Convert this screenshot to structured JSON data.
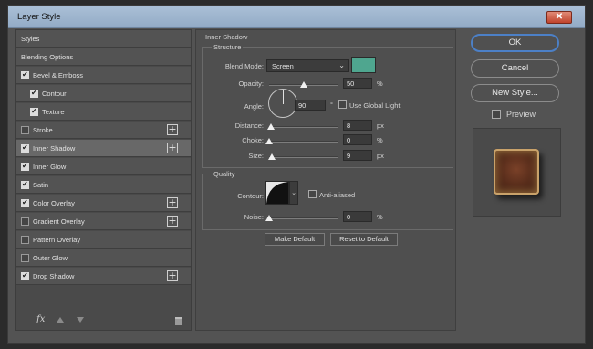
{
  "window": {
    "title": "Layer Style",
    "close_label": "✕"
  },
  "sidebar": {
    "items": [
      {
        "label": "Styles",
        "checkbox": null,
        "plus": false,
        "selected": false,
        "indent": 0
      },
      {
        "label": "Blending Options",
        "checkbox": null,
        "plus": false,
        "selected": false,
        "indent": 0
      },
      {
        "label": "Bevel & Emboss",
        "checkbox": true,
        "plus": false,
        "selected": false,
        "indent": 0
      },
      {
        "label": "Contour",
        "checkbox": true,
        "plus": false,
        "selected": false,
        "indent": 1
      },
      {
        "label": "Texture",
        "checkbox": true,
        "plus": false,
        "selected": false,
        "indent": 1
      },
      {
        "label": "Stroke",
        "checkbox": false,
        "plus": true,
        "selected": false,
        "indent": 0
      },
      {
        "label": "Inner Shadow",
        "checkbox": true,
        "plus": true,
        "selected": true,
        "indent": 0
      },
      {
        "label": "Inner Glow",
        "checkbox": true,
        "plus": false,
        "selected": false,
        "indent": 0
      },
      {
        "label": "Satin",
        "checkbox": true,
        "plus": false,
        "selected": false,
        "indent": 0
      },
      {
        "label": "Color Overlay",
        "checkbox": true,
        "plus": true,
        "selected": false,
        "indent": 0
      },
      {
        "label": "Gradient Overlay",
        "checkbox": false,
        "plus": true,
        "selected": false,
        "indent": 0
      },
      {
        "label": "Pattern Overlay",
        "checkbox": false,
        "plus": false,
        "selected": false,
        "indent": 0
      },
      {
        "label": "Outer Glow",
        "checkbox": false,
        "plus": false,
        "selected": false,
        "indent": 0
      },
      {
        "label": "Drop Shadow",
        "checkbox": true,
        "plus": true,
        "selected": false,
        "indent": 0
      }
    ],
    "footer": {
      "fx_label": "fx"
    }
  },
  "inner_shadow": {
    "section_title": "Inner Shadow",
    "structure_title": "Structure",
    "blend_mode_label": "Blend Mode:",
    "blend_mode_value": "Screen",
    "swatch_color": "#4fa68f",
    "opacity_label": "Opacity:",
    "opacity_value": "50",
    "opacity_fraction": 0.5,
    "angle_label": "Angle:",
    "angle_value": "90",
    "angle_unit": "°",
    "use_global_light_label": "Use Global Light",
    "distance_label": "Distance:",
    "distance_value": "8",
    "distance_fraction": 0.03,
    "choke_label": "Choke:",
    "choke_value": "0",
    "choke_fraction": 0.0,
    "size_label": "Size:",
    "size_value": "9",
    "size_fraction": 0.04,
    "quality_title": "Quality",
    "contour_label": "Contour:",
    "anti_aliased_label": "Anti-aliased",
    "noise_label": "Noise:",
    "noise_value": "0",
    "noise_fraction": 0.0,
    "unit_percent": "%",
    "unit_px": "px",
    "make_default_label": "Make Default",
    "reset_default_label": "Reset to Default"
  },
  "right_panel": {
    "ok_label": "OK",
    "cancel_label": "Cancel",
    "new_style_label": "New Style...",
    "preview_label": "Preview"
  }
}
